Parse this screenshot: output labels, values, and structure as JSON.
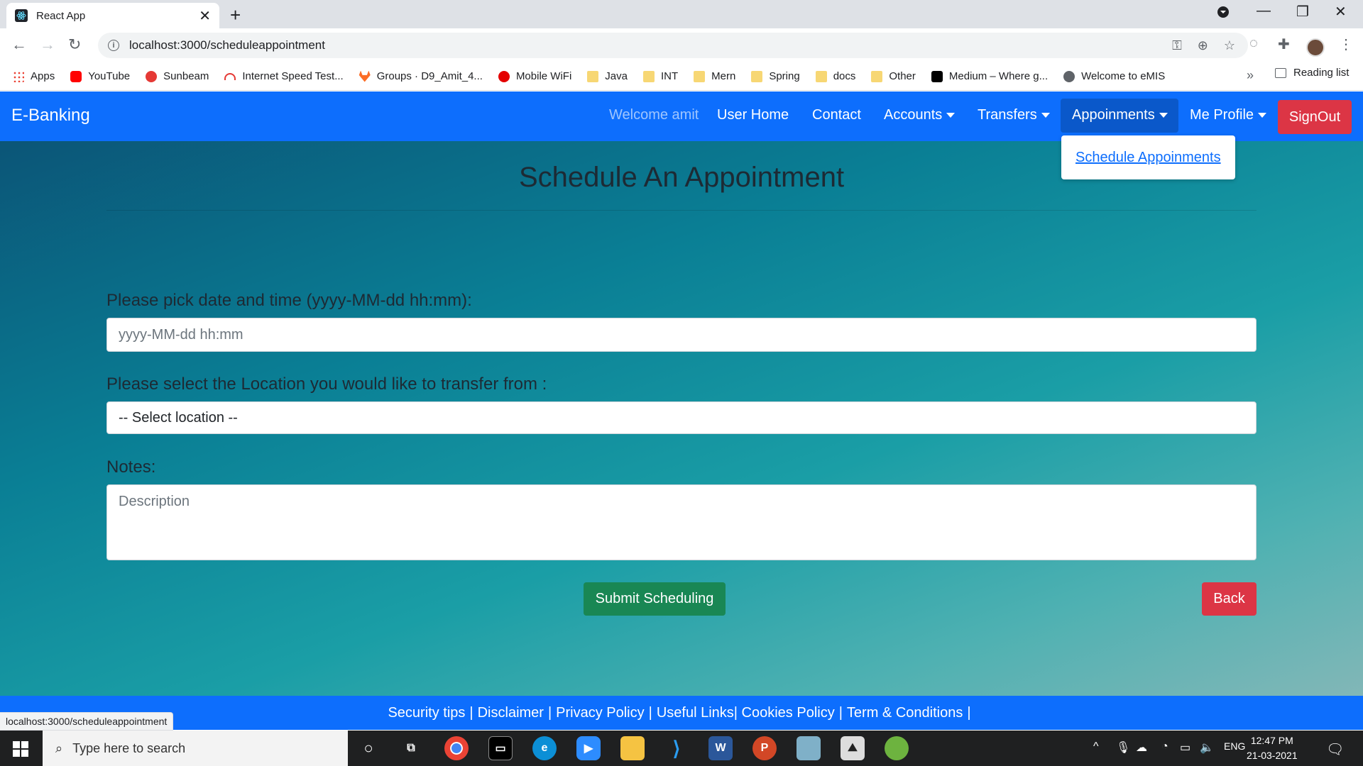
{
  "browser": {
    "tab_title": "React App",
    "url": "localhost:3000/scheduleappointment",
    "bookmarks": [
      "Apps",
      "YouTube",
      "Sunbeam",
      "Internet Speed Test...",
      "Groups · D9_Amit_4...",
      "Mobile WiFi",
      "Java",
      "INT",
      "Mern",
      "Spring",
      "docs",
      "Other",
      "Medium – Where g...",
      "Welcome to eMIS"
    ],
    "more_bookmarks": "»",
    "reading_list": "Reading list",
    "status_url": "localhost:3000/scheduleappointment"
  },
  "navbar": {
    "brand": "E-Banking",
    "welcome": "Welcome amit",
    "items": [
      "User Home",
      "Contact",
      "Accounts",
      "Transfers",
      "Appoinments",
      "Me Profile"
    ],
    "signout": "SignOut",
    "dropdown_item": "Schedule Appoinments"
  },
  "form": {
    "title": "Schedule An Appointment",
    "date_label": "Please pick date and time (yyyy-MM-dd hh:mm):",
    "date_placeholder": "yyyy-MM-dd hh:mm",
    "location_label": "Please select the Location you would like to transfer from :",
    "location_selected": "-- Select location --",
    "notes_label": "Notes:",
    "notes_placeholder": "Description",
    "submit": "Submit Scheduling",
    "back": "Back"
  },
  "footer": {
    "links": [
      "Security tips",
      "Disclaimer",
      "Privacy Policy",
      "Useful Links",
      "Cookies Policy",
      "Term & Conditions"
    ]
  },
  "taskbar": {
    "search_placeholder": "Type here to search",
    "lang": "ENG",
    "time": "12:47 PM",
    "date": "21-03-2021"
  },
  "colors": {
    "primary": "#0d6efd",
    "danger": "#dc3545",
    "success": "#198754"
  }
}
